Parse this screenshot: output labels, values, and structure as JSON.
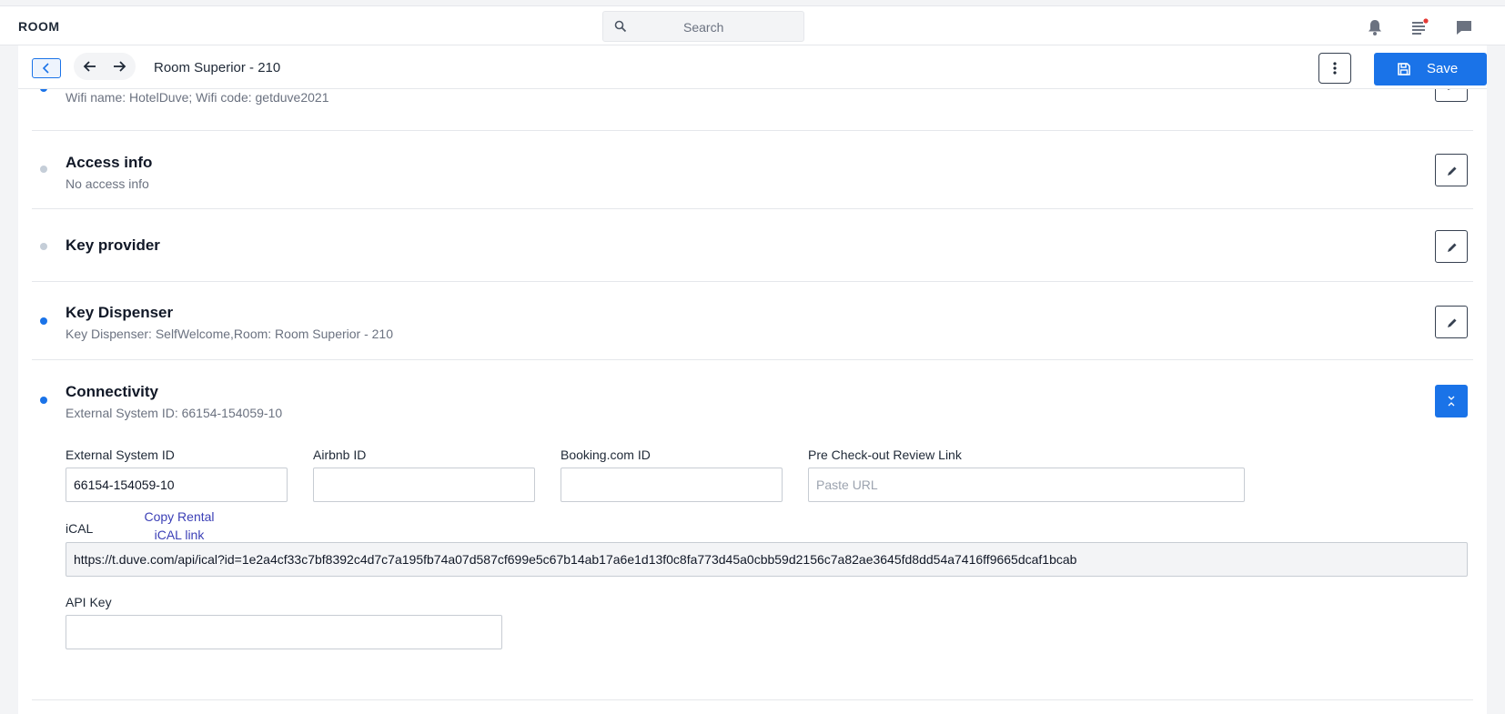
{
  "app": {
    "brand": "ROOM"
  },
  "search": {
    "placeholder": "Search"
  },
  "header": {
    "title": "Room Superior - 210",
    "save_label": "Save"
  },
  "sections": [
    {
      "title": "",
      "subtitle": "Wifi name: HotelDuve; Wifi code: getduve2021",
      "status": "active"
    },
    {
      "title": "Access info",
      "subtitle": "No access info",
      "status": "inactive"
    },
    {
      "title": "Key provider",
      "subtitle": "",
      "status": "inactive"
    },
    {
      "title": "Key Dispenser",
      "subtitle": "Key Dispenser: SelfWelcome,Room: Room Superior - 210",
      "status": "active"
    },
    {
      "title": "Connectivity",
      "subtitle": "External System ID: 66154-154059-10",
      "status": "active",
      "expanded": true
    }
  ],
  "connectivity": {
    "external_system_id": {
      "label": "External System ID",
      "value": "66154-154059-10"
    },
    "airbnb_id": {
      "label": "Airbnb ID",
      "value": ""
    },
    "booking_id": {
      "label": "Booking.com ID",
      "value": ""
    },
    "review_link": {
      "label": "Pre Check-out Review Link",
      "placeholder": "Paste URL",
      "value": ""
    },
    "ical": {
      "label": "iCAL",
      "copy_link": "Copy Rental iCAL link",
      "value": "https://t.duve.com/api/ical?id=1e2a4cf33c7bf8392c4d7c7a195fb74a07d587cf699e5c67b14ab17a6e1d13f0c8fa773d45a0cbb59d2156c7a82ae3645fd8dd54a7416ff9665dcaf1bcab"
    },
    "api_key": {
      "label": "API Key",
      "value": ""
    }
  },
  "colors": {
    "accent": "#1a73e8",
    "inactive_dot": "#c5ced8",
    "link": "#3b3fb6"
  },
  "icons": [
    "search-icon",
    "bell-icon",
    "notes-icon",
    "chat-icon",
    "chevron-left-icon",
    "arrow-left-icon",
    "arrow-right-icon",
    "more-vertical-icon",
    "save-icon",
    "pencil-icon",
    "collapse-icon"
  ]
}
